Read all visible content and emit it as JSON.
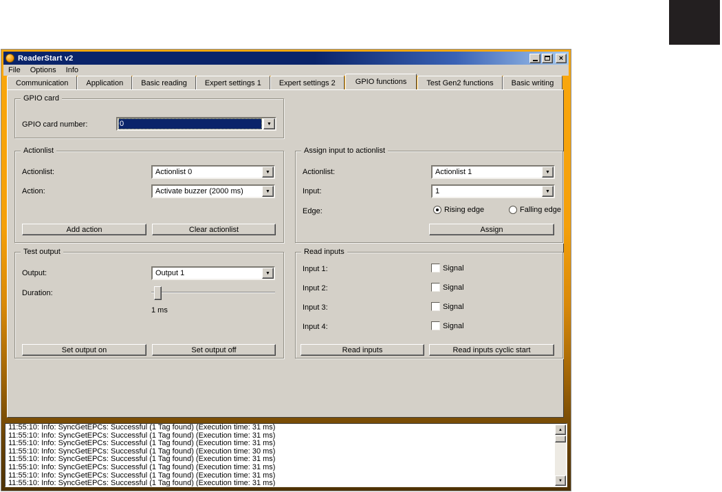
{
  "window": {
    "title": "ReaderStart v2",
    "menu": [
      "File",
      "Options",
      "Info"
    ]
  },
  "tabs": [
    {
      "label": "Communication"
    },
    {
      "label": "Application"
    },
    {
      "label": "Basic reading"
    },
    {
      "label": "Expert settings 1"
    },
    {
      "label": "Expert settings 2"
    },
    {
      "label": "GPIO functions",
      "active": true
    },
    {
      "label": "Test Gen2 functions"
    },
    {
      "label": "Basic writing"
    }
  ],
  "gpio_card": {
    "legend": "GPIO card",
    "label": "GPIO card number:",
    "value": "0"
  },
  "actionlist": {
    "legend": "Actionlist",
    "actionlist_label": "Actionlist:",
    "actionlist_value": "Actionlist 0",
    "action_label": "Action:",
    "action_value": "Activate buzzer (2000 ms)",
    "add_button": "Add action",
    "clear_button": "Clear actionlist"
  },
  "assign": {
    "legend": "Assign input to actionlist",
    "actionlist_label": "Actionlist:",
    "actionlist_value": "Actionlist 1",
    "input_label": "Input:",
    "input_value": "1",
    "edge_label": "Edge:",
    "rising_label": "Rising edge",
    "falling_label": "Falling edge",
    "rising_selected": true,
    "falling_selected": false,
    "assign_button": "Assign"
  },
  "test_output": {
    "legend": "Test output",
    "output_label": "Output:",
    "output_value": "Output 1",
    "duration_label": "Duration:",
    "duration_value": "1 ms",
    "on_button": "Set output on",
    "off_button": "Set output off"
  },
  "read_inputs": {
    "legend": "Read inputs",
    "rows": [
      {
        "label": "Input 1:",
        "checkbox": "Signal",
        "checked": false
      },
      {
        "label": "Input 2:",
        "checkbox": "Signal",
        "checked": false
      },
      {
        "label": "Input 3:",
        "checkbox": "Signal",
        "checked": false
      },
      {
        "label": "Input 4:",
        "checkbox": "Signal",
        "checked": false
      }
    ],
    "read_button": "Read inputs",
    "cyclic_button": "Read inputs cyclic start"
  },
  "log": {
    "lines": [
      "11:55:10: Info: SyncGetEPCs: Successful (1 Tag found) (Execution time: 31 ms)",
      "11:55:10: Info: SyncGetEPCs: Successful (1 Tag found) (Execution time: 31 ms)",
      "11:55:10: Info: SyncGetEPCs: Successful (1 Tag found) (Execution time: 31 ms)",
      "11:55:10: Info: SyncGetEPCs: Successful (1 Tag found) (Execution time: 30 ms)",
      "11:55:10: Info: SyncGetEPCs: Successful (1 Tag found) (Execution time: 31 ms)",
      "11:55:10: Info: SyncGetEPCs: Successful (1 Tag found) (Execution time: 31 ms)",
      "11:55:10: Info: SyncGetEPCs: Successful (1 Tag found) (Execution time: 31 ms)",
      "11:55:10: Info: SyncGetEPCs: Successful (1 Tag found) (Execution time: 31 ms)"
    ]
  },
  "colors": {
    "accent_orange": "#F7A30B",
    "frame_brown": "#5C3A06",
    "titlebar_navy": "#0A246A",
    "titlebar_light": "#A6CAF0",
    "ui_grey": "#D4D0C8",
    "selection_navy": "#0A246A"
  }
}
